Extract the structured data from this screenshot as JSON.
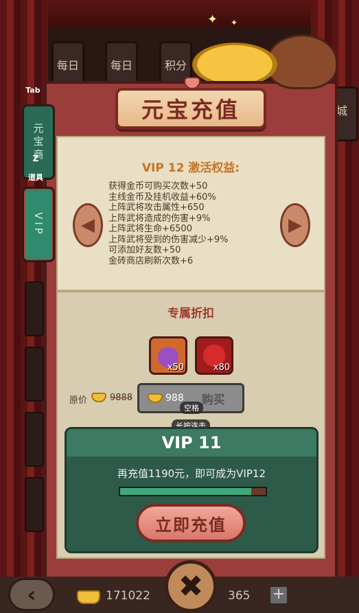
{
  "background": {
    "boards": [
      "每日",
      "每日",
      "积分"
    ],
    "right_board": "城"
  },
  "sidebar": {
    "tab_key": "Tab",
    "menu_label": "菜单",
    "tab1_label": "元宝商",
    "tab1_key": "Z",
    "items_label": "道具",
    "tab2_label": "VIP"
  },
  "title": "元宝充值",
  "vip_benefits": {
    "heading": "VIP 12 激活权益:",
    "lines": [
      "获得金币可购买次数+50",
      "主线金币及挂机收益+60%",
      "上阵武将攻击属性+650",
      "上阵武将造成的伤害+9%",
      "上阵武将生命+6500",
      "上阵武将受到的伤害减少+9%",
      "可添加好友数+50",
      "金砖商店刷新次数+6"
    ]
  },
  "discount": {
    "heading": "专属折扣",
    "items": [
      {
        "icon": "treasure-bag-icon",
        "qty": "x50"
      },
      {
        "icon": "red-chest-icon",
        "qty": "x80"
      }
    ],
    "original_price_label": "原价",
    "original_price": "9888",
    "price": "988",
    "buy_label": "购买",
    "space_hint": "空格",
    "long_press_hint": "长按连击"
  },
  "vip_progress": {
    "level": "VIP 11",
    "message": "再充值1190元，即可成为VIP12",
    "progress_fraction": 0.9,
    "recharge_label": "立即充值"
  },
  "bottom": {
    "gold": "171022",
    "ingots": "365",
    "plus": "+"
  },
  "colors": {
    "panel": "#9b3d3a",
    "vip_card": "#2e5a4a",
    "progress_fill": "#3fa97c",
    "heading_gold": "#c57426"
  }
}
